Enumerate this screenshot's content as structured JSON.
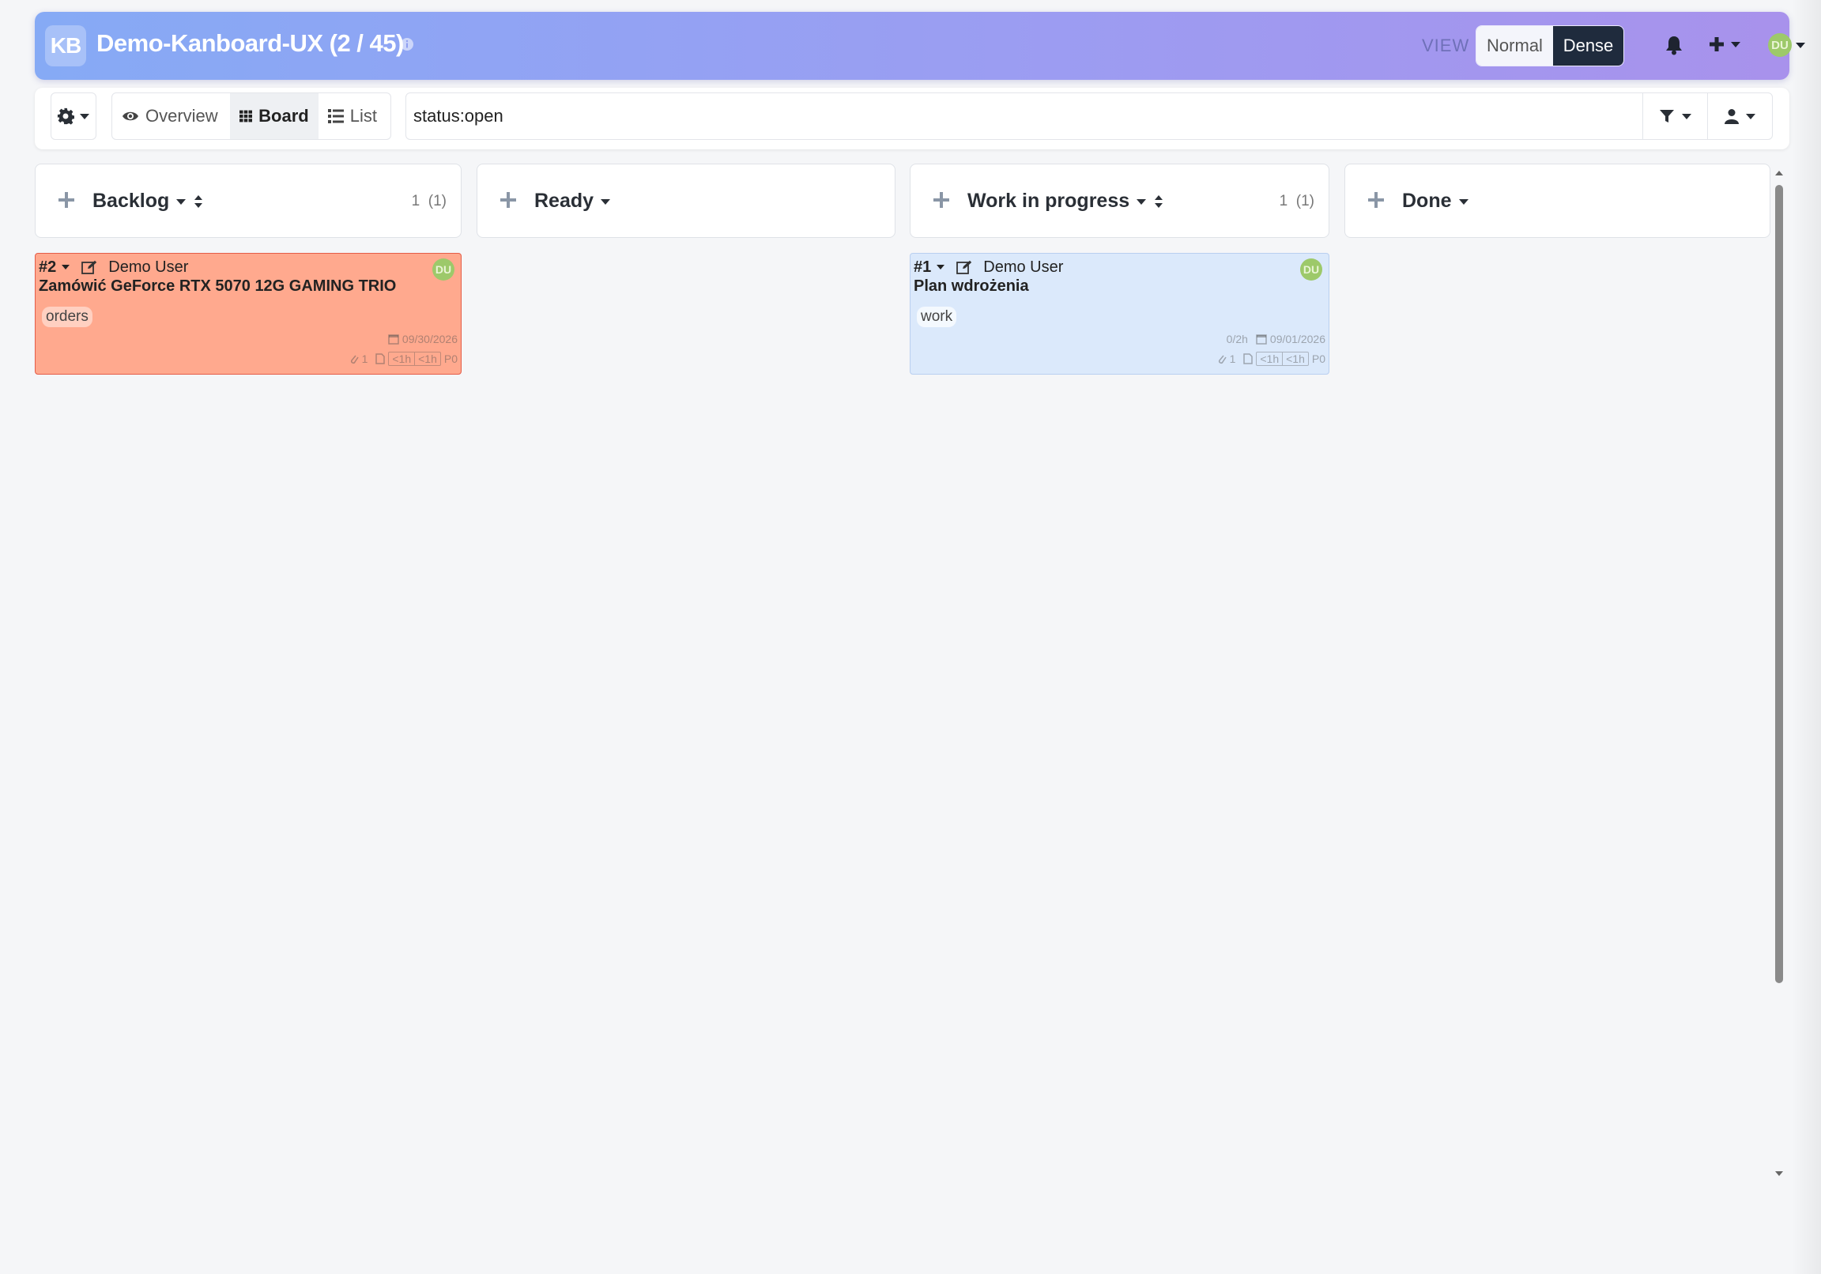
{
  "header": {
    "logo": "KB",
    "project_title": "Demo-Kanboard-UX (2 / 45)",
    "view_label": "VIEW",
    "view_normal": "Normal",
    "view_dense": "Dense",
    "user_initials": "DU"
  },
  "toolbar": {
    "tabs": [
      {
        "label": "Overview",
        "icon": "eye-icon"
      },
      {
        "label": "Board",
        "icon": "grid-icon"
      },
      {
        "label": "List",
        "icon": "list-icon"
      }
    ],
    "search_value": "status:open"
  },
  "columns": [
    {
      "title": "Backlog",
      "count": "1",
      "count_total": "(1)"
    },
    {
      "title": "Ready",
      "count": "",
      "count_total": ""
    },
    {
      "title": "Work in progress",
      "count": "1",
      "count_total": "(1)"
    },
    {
      "title": "Done",
      "count": "",
      "count_total": ""
    }
  ],
  "cards": [
    {
      "id": "#2",
      "user": "Demo User",
      "avatar": "DU",
      "title": "Zamówić GeForce RTX 5070 12G GAMING TRIO",
      "tag": "orders",
      "time_spent": "",
      "due_date": "09/30/2026",
      "attachments": "1",
      "est1": "<1h",
      "est2": "<1h",
      "priority": "P0",
      "color": "#ffa98e"
    },
    {
      "id": "#1",
      "user": "Demo User",
      "avatar": "DU",
      "title": "Plan wdrożenia",
      "tag": "work",
      "time_spent": "0/2h",
      "due_date": "09/01/2026",
      "attachments": "1",
      "est1": "<1h",
      "est2": "<1h",
      "priority": "P0",
      "color": "#dbe9fb"
    }
  ],
  "colors": {
    "header_gradient_start": "#86aaf5",
    "header_gradient_end": "#a892ec",
    "dense_active": "#1f2b3d",
    "avatar": "#9dc96a"
  }
}
